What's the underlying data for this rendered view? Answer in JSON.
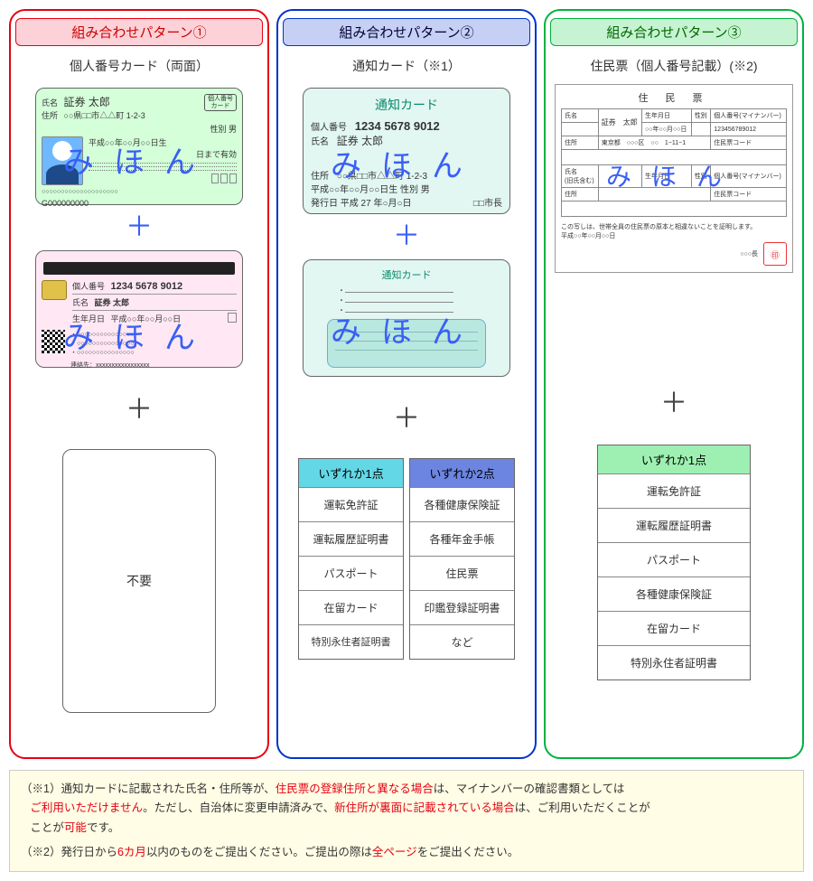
{
  "panels": {
    "p1": {
      "title": "組み合わせパターン①",
      "subtitle": "個人番号カード（両面）",
      "fuyou": "不要"
    },
    "p2": {
      "title": "組み合わせパターン②",
      "subtitle": "通知カード（※1）"
    },
    "p3": {
      "title": "組み合わせパターン③",
      "subtitle": "住民票（個人番号記載）(※2)"
    }
  },
  "mihon": "みほん",
  "mncard": {
    "badge": "個人番号\nカード",
    "name_label": "氏名",
    "name": "証券 太郎",
    "addr_label": "住所",
    "addr": "○○県□□市△△町 1-2-3",
    "sex_label": "性別 男",
    "dob": "平成○○年○○月○○日生",
    "valid": "日まで有効",
    "serial": "G000000000",
    "number_label": "個人番号",
    "number": "1234 5678 9012",
    "name2_label": "氏名",
    "name2": "証券 太郎",
    "dob2_label": "生年月日",
    "dob2": "平成○○年○○月○○日",
    "contact": "連絡先：xxxxxxxxxxxxxxxxx"
  },
  "tsuchi": {
    "title": "通知カード",
    "number_label": "個人番号",
    "number": "1234 5678 9012",
    "name_label": "氏名",
    "name": "証券 太郎",
    "addr_label": "住所",
    "addr": "○○県□□市△△町 1-2-3",
    "dob": "平成○○年○○月○○日生 性別 男",
    "issue": "発行日 平成 27 年○月○日",
    "mayor": "□□市長"
  },
  "juminhyo": {
    "title": "住 民 票",
    "name_label": "氏名",
    "name": "証券　太郎",
    "dob_label": "生年月日",
    "dob": "○○年○○月○○日",
    "sex_label": "性別",
    "mn_label": "個人番号(マイナンバー)",
    "mn": "123456789012",
    "addr_label": "住所",
    "addr": "東京都　○○○区　○○　1−11−1",
    "code_label": "住民票コード",
    "cert": "この写しは、世帯全員の住民票の原本と相違ないことを証明します。",
    "date": "平成○○年○○月○○日",
    "issuer": "○○○長",
    "prev_label": "氏名\n(旧氏含む)"
  },
  "docbox": {
    "h1": "いずれか1点",
    "h2": "いずれか2点",
    "h3": "いずれか1点",
    "a": [
      "運転免許証",
      "運転履歴証明書",
      "パスポート",
      "在留カード",
      "特別永住者証明書"
    ],
    "b": [
      "各種健康保険証",
      "各種年金手帳",
      "住民票",
      "印鑑登録証明書",
      "など"
    ],
    "c": [
      "運転免許証",
      "運転履歴証明書",
      "パスポート",
      "各種健康保険証",
      "在留カード",
      "特別永住者証明書"
    ]
  },
  "notes": {
    "n1a": "（※1）通知カードに記載された氏名・住所等が、",
    "n1b": "住民票の登録住所と異なる場合",
    "n1c": "は、マイナンバーの確認書類としては",
    "n1d": "ご利用いただけません",
    "n1e": "。ただし、自治体に変更申請済みで、",
    "n1f": "新住所が裏面に記載されている場合",
    "n1g": "は、ご利用いただくことが",
    "n1h": "可能",
    "n1i": "です。",
    "n2a": "（※2）発行日から",
    "n2b": "6カ月",
    "n2c": "以内のものをご提出ください。ご提出の際は",
    "n2d": "全ページ",
    "n2e": "をご提出ください。"
  }
}
